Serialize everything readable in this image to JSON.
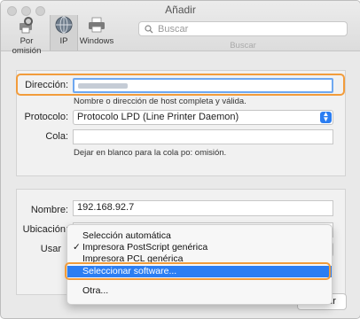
{
  "window": {
    "title": "Añadir"
  },
  "toolbar": {
    "default_label": "Por omisión",
    "ip_label": "IP",
    "windows_label": "Windows",
    "search_placeholder": "Buscar",
    "search_caption": "Buscar"
  },
  "form": {
    "address_label": "Dirección:",
    "address_hint": "Nombre o dirección de host completa y válida.",
    "protocol_label": "Protocolo:",
    "protocol_value": "Protocolo LPD (Line Printer Daemon)",
    "queue_label": "Cola:",
    "queue_hint": "Dejar en blanco para la cola po: omisión.",
    "name_label": "Nombre:",
    "name_value": "192.168.92.7",
    "location_label": "Ubicación:",
    "use_label": "Usar"
  },
  "use_menu": {
    "items": [
      {
        "label": "Selección automática",
        "checked": false
      },
      {
        "label": "Impresora PostScript genérica",
        "checked": true
      },
      {
        "label": "Impresora PCL genérica",
        "checked": false
      },
      {
        "label": "Seleccionar software...",
        "checked": false,
        "highlighted": true
      }
    ],
    "other": "Otra...",
    "check_glyph": "✓"
  },
  "buttons": {
    "add": "Añadir"
  },
  "colors": {
    "accent": "#2c7ef2",
    "annotation": "#f29c3b"
  }
}
